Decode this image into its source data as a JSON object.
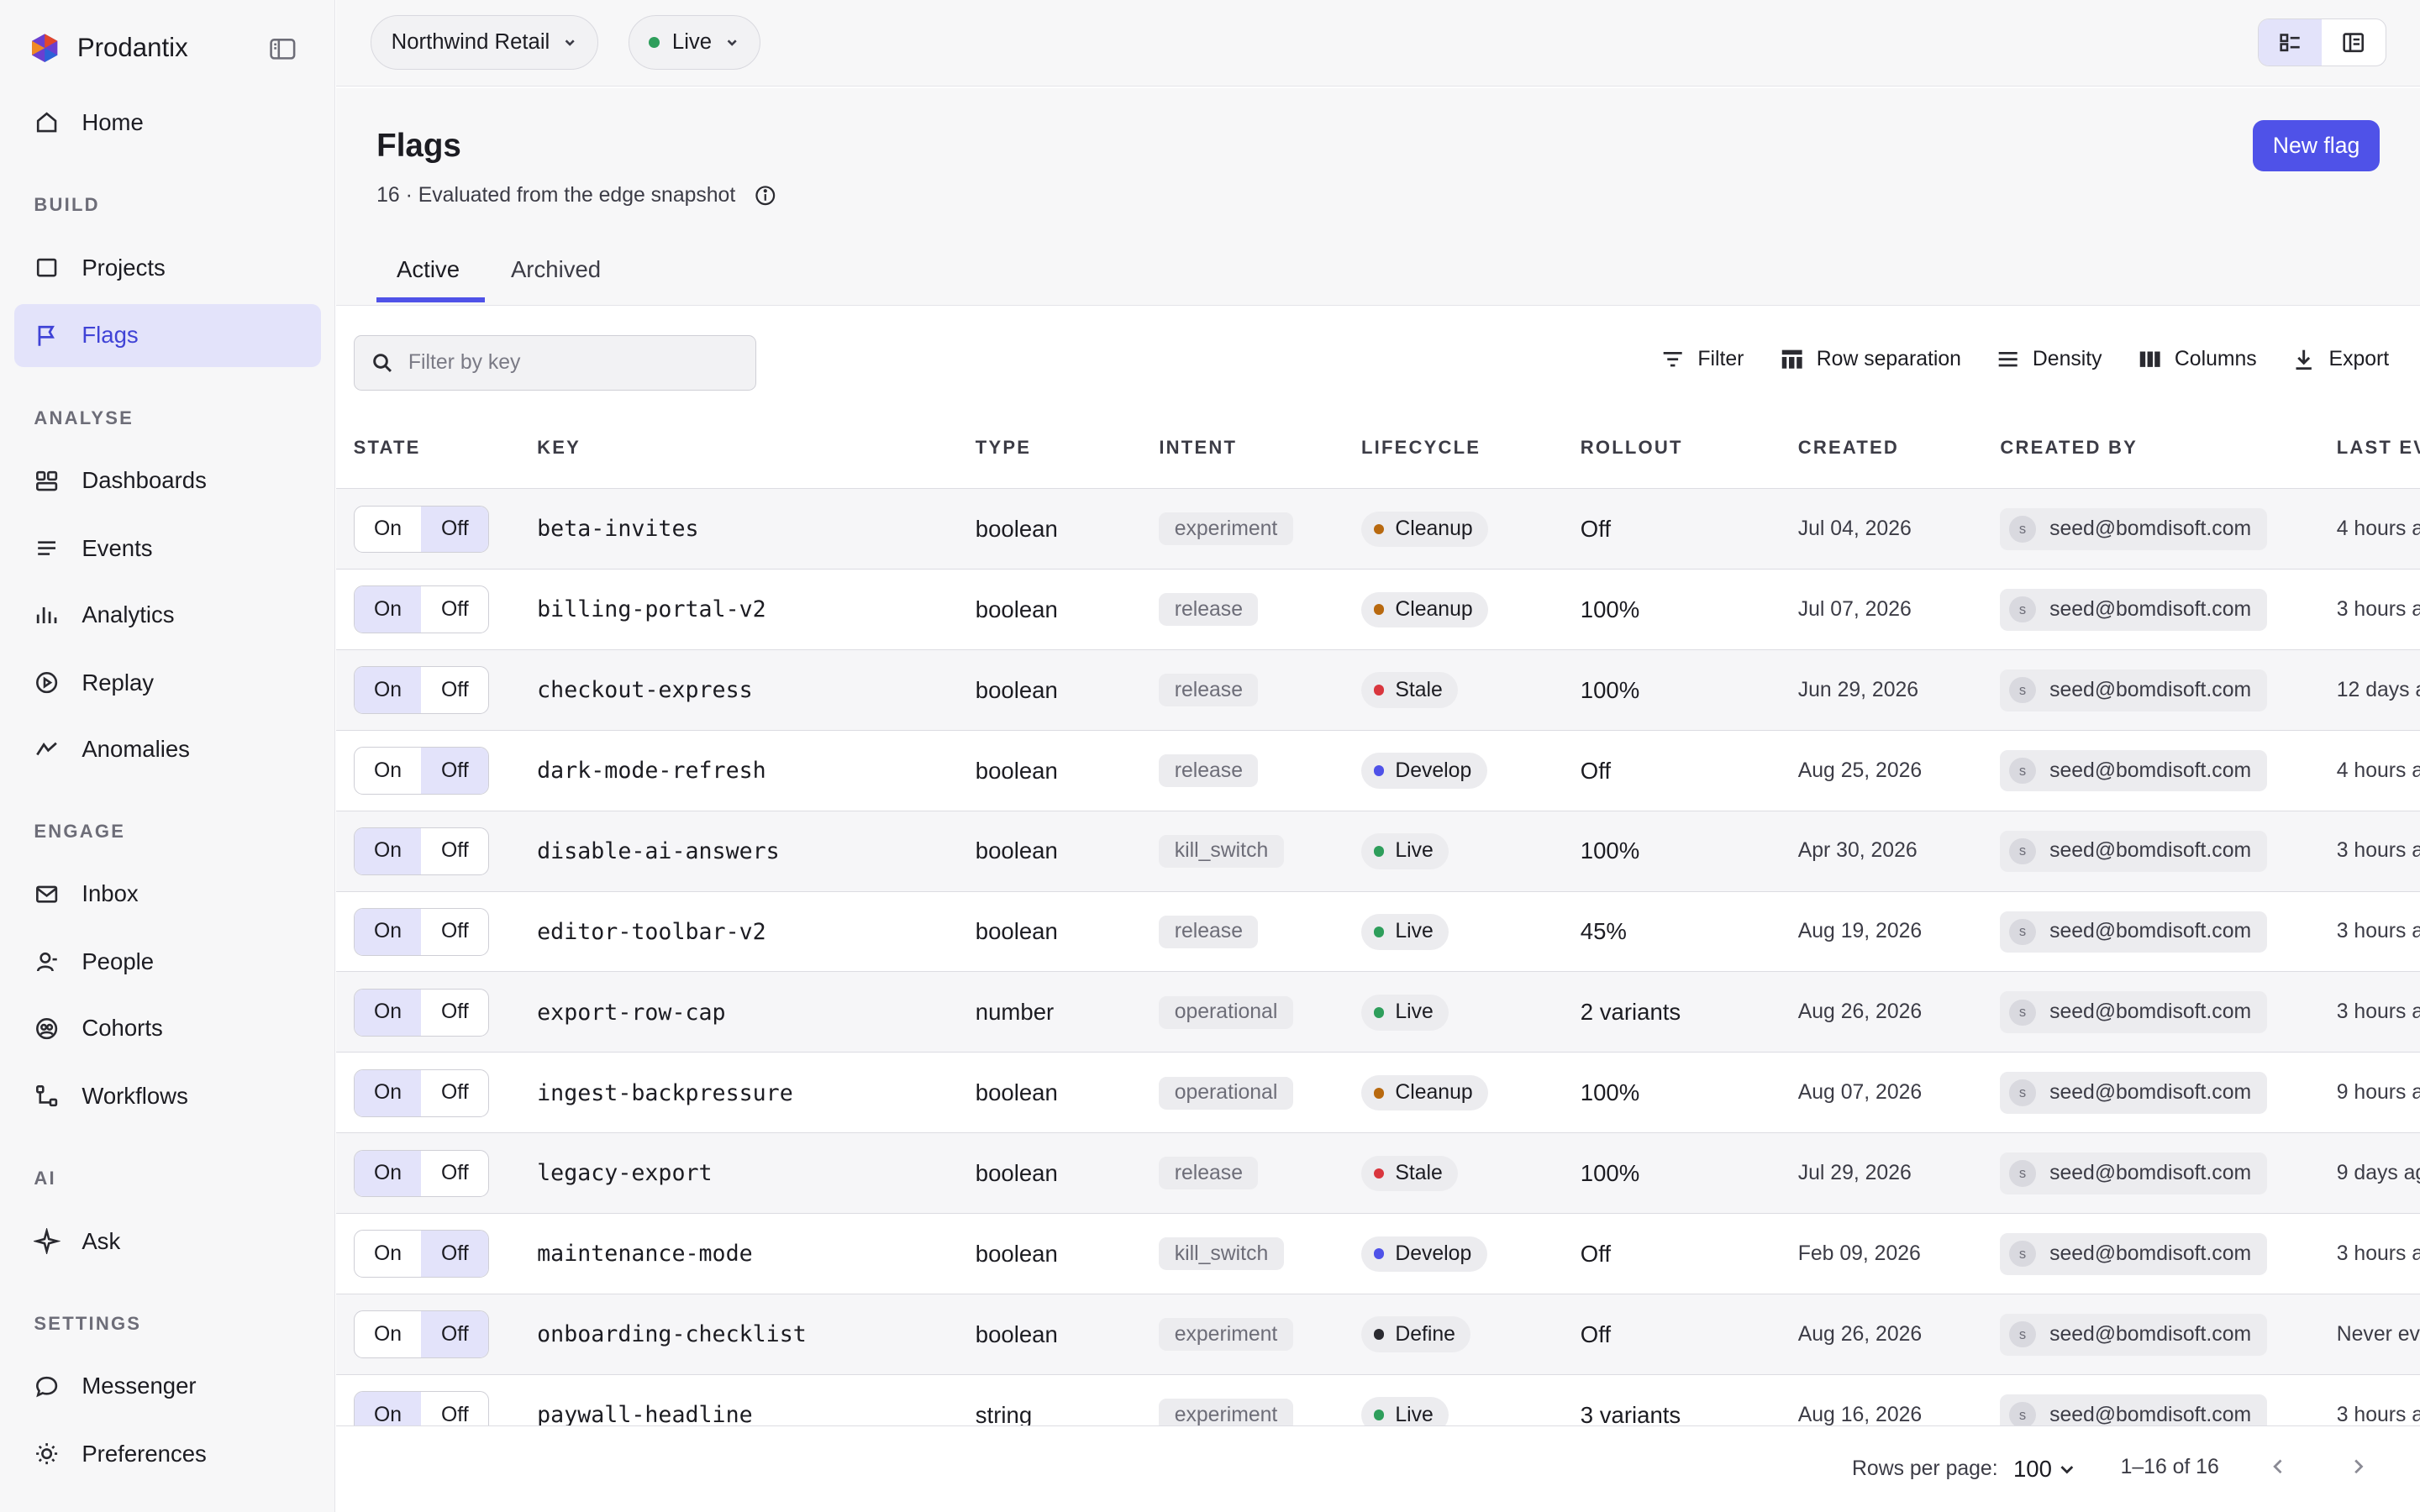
{
  "app": {
    "name": "Prodantix"
  },
  "sidebar": {
    "home": "Home",
    "sections": {
      "build": "BUILD",
      "analyse": "ANALYSE",
      "engage": "ENGAGE",
      "ai": "AI",
      "settings": "SETTINGS"
    },
    "items": {
      "projects": "Projects",
      "flags": "Flags",
      "dashboards": "Dashboards",
      "events": "Events",
      "analytics": "Analytics",
      "replay": "Replay",
      "anomalies": "Anomalies",
      "inbox": "Inbox",
      "people": "People",
      "cohorts": "Cohorts",
      "workflows": "Workflows",
      "ask": "Ask",
      "messenger": "Messenger",
      "preferences": "Preferences"
    }
  },
  "topbar": {
    "workspace": "Northwind Retail",
    "environment": "Live",
    "env_color": "#2e9e5b"
  },
  "page": {
    "title": "Flags",
    "count": "16",
    "subtitle": "Evaluated from the edge snapshot",
    "new_button": "New flag",
    "tabs": {
      "active": "Active",
      "archived": "Archived"
    }
  },
  "toolbar": {
    "search_placeholder": "Filter by key",
    "filter": "Filter",
    "row_separation": "Row separation",
    "density": "Density",
    "columns": "Columns",
    "export": "Export"
  },
  "table": {
    "headers": {
      "state": "STATE",
      "key": "KEY",
      "type": "TYPE",
      "intent": "INTENT",
      "lifecycle": "LIFECYCLE",
      "rollout": "ROLLOUT",
      "created": "CREATED",
      "created_by": "CREATED BY",
      "last_event": "LAST EV"
    },
    "toggle": {
      "on": "On",
      "off": "Off"
    },
    "lifecycle_colors": {
      "Cleanup": "#b8690f",
      "Stale": "#d9363e",
      "Develop": "#4f52e8",
      "Live": "#2e9e5b",
      "Define": "#2a2a30"
    },
    "rows": [
      {
        "state": "off",
        "key": "beta-invites",
        "type": "boolean",
        "intent": "experiment",
        "lifecycle": "Cleanup",
        "rollout": "Off",
        "created": "Jul 04, 2026",
        "avatar": "s",
        "created_by": "seed@bomdisoft.com",
        "last_event": "4 hours a"
      },
      {
        "state": "on",
        "key": "billing-portal-v2",
        "type": "boolean",
        "intent": "release",
        "lifecycle": "Cleanup",
        "rollout": "100%",
        "created": "Jul 07, 2026",
        "avatar": "s",
        "created_by": "seed@bomdisoft.com",
        "last_event": "3 hours a"
      },
      {
        "state": "on",
        "key": "checkout-express",
        "type": "boolean",
        "intent": "release",
        "lifecycle": "Stale",
        "rollout": "100%",
        "created": "Jun 29, 2026",
        "avatar": "s",
        "created_by": "seed@bomdisoft.com",
        "last_event": "12 days a"
      },
      {
        "state": "off",
        "key": "dark-mode-refresh",
        "type": "boolean",
        "intent": "release",
        "lifecycle": "Develop",
        "rollout": "Off",
        "created": "Aug 25, 2026",
        "avatar": "s",
        "created_by": "seed@bomdisoft.com",
        "last_event": "4 hours a"
      },
      {
        "state": "on",
        "key": "disable-ai-answers",
        "type": "boolean",
        "intent": "kill_switch",
        "lifecycle": "Live",
        "rollout": "100%",
        "created": "Apr 30, 2026",
        "avatar": "s",
        "created_by": "seed@bomdisoft.com",
        "last_event": "3 hours a"
      },
      {
        "state": "on",
        "key": "editor-toolbar-v2",
        "type": "boolean",
        "intent": "release",
        "lifecycle": "Live",
        "rollout": "45%",
        "created": "Aug 19, 2026",
        "avatar": "s",
        "created_by": "seed@bomdisoft.com",
        "last_event": "3 hours a"
      },
      {
        "state": "on",
        "key": "export-row-cap",
        "type": "number",
        "intent": "operational",
        "lifecycle": "Live",
        "rollout": "2 variants",
        "created": "Aug 26, 2026",
        "avatar": "s",
        "created_by": "seed@bomdisoft.com",
        "last_event": "3 hours a"
      },
      {
        "state": "on",
        "key": "ingest-backpressure",
        "type": "boolean",
        "intent": "operational",
        "lifecycle": "Cleanup",
        "rollout": "100%",
        "created": "Aug 07, 2026",
        "avatar": "s",
        "created_by": "seed@bomdisoft.com",
        "last_event": "9 hours a"
      },
      {
        "state": "on",
        "key": "legacy-export",
        "type": "boolean",
        "intent": "release",
        "lifecycle": "Stale",
        "rollout": "100%",
        "created": "Jul 29, 2026",
        "avatar": "s",
        "created_by": "seed@bomdisoft.com",
        "last_event": "9 days ag"
      },
      {
        "state": "off",
        "key": "maintenance-mode",
        "type": "boolean",
        "intent": "kill_switch",
        "lifecycle": "Develop",
        "rollout": "Off",
        "created": "Feb 09, 2026",
        "avatar": "s",
        "created_by": "seed@bomdisoft.com",
        "last_event": "3 hours a"
      },
      {
        "state": "off",
        "key": "onboarding-checklist",
        "type": "boolean",
        "intent": "experiment",
        "lifecycle": "Define",
        "rollout": "Off",
        "created": "Aug 26, 2026",
        "avatar": "s",
        "created_by": "seed@bomdisoft.com",
        "last_event": "Never ev"
      },
      {
        "state": "on",
        "key": "paywall-headline",
        "type": "string",
        "intent": "experiment",
        "lifecycle": "Live",
        "rollout": "3 variants",
        "created": "Aug 16, 2026",
        "avatar": "s",
        "created_by": "seed@bomdisoft.com",
        "last_event": "3 hours a"
      }
    ]
  },
  "footer": {
    "rows_per_page_label": "Rows per page:",
    "rows_per_page": "100",
    "range": "1–16 of 16"
  }
}
